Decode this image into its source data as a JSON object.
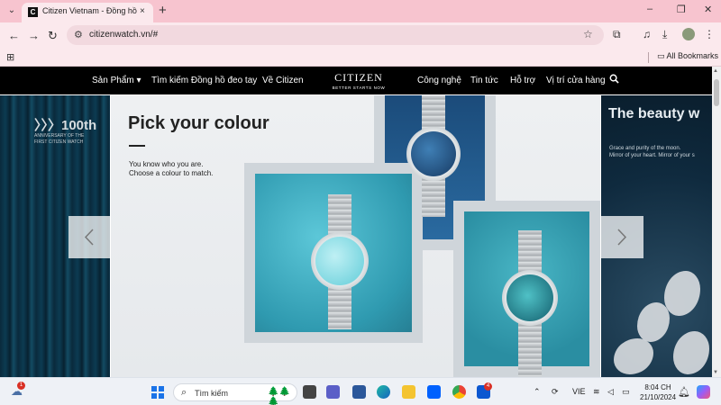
{
  "browser": {
    "tab": {
      "favicon": "C",
      "title": "Citizen Vietnam - Đồng hồ cao",
      "close_icon": "×"
    },
    "new_tab_icon": "+",
    "window_controls": {
      "minimize": "–",
      "maximize": "❐",
      "close": "✕"
    },
    "toolbar": {
      "back": "←",
      "forward": "→",
      "reload": "↻",
      "site_info": "⚙",
      "url": "citizenwatch.vn/#",
      "bookmark_star": "☆"
    },
    "bookmarks_bar": {
      "apps_icon": "⊞",
      "all_bookmarks": "All Bookmarks"
    }
  },
  "site": {
    "nav": {
      "products": "Sản Phẩm",
      "products_chevron": "▾",
      "find_watch": "Tìm kiếm Đồng hồ đeo tay",
      "about": "Về Citizen",
      "logo": "CITIZEN",
      "tagline": "BETTER STARTS NOW",
      "technology": "Công nghệ",
      "news": "Tin tức",
      "support": "Hỗ trợ",
      "stores": "Vị trí cửa hàng"
    },
    "hero": {
      "left_slide": {
        "number": "〉〉〉100th",
        "text": "ANNIVERSARY OF THE FIRST CITIZEN WATCH"
      },
      "main_slide": {
        "headline": "Pick your colour",
        "subcopy_line1": "You know who you are.",
        "subcopy_line2": "Choose a colour to match."
      },
      "right_slide": {
        "title": "The beauty w",
        "sub_line1": "Grace and purity of the moon.",
        "sub_line2": "Mirror of your heart. Mirror of your s"
      }
    }
  },
  "taskbar": {
    "weather_badge": "1",
    "search_placeholder": "Tìm kiếm",
    "app_badge": "4",
    "language": "VIE",
    "time": "8:04 CH",
    "date": "21/10/2024"
  },
  "colors": {
    "tab_strip": "#f7c4cf",
    "site_nav": "#000000",
    "accent_teal": "#2f9ab0",
    "accent_blue": "#1b4b7a"
  }
}
